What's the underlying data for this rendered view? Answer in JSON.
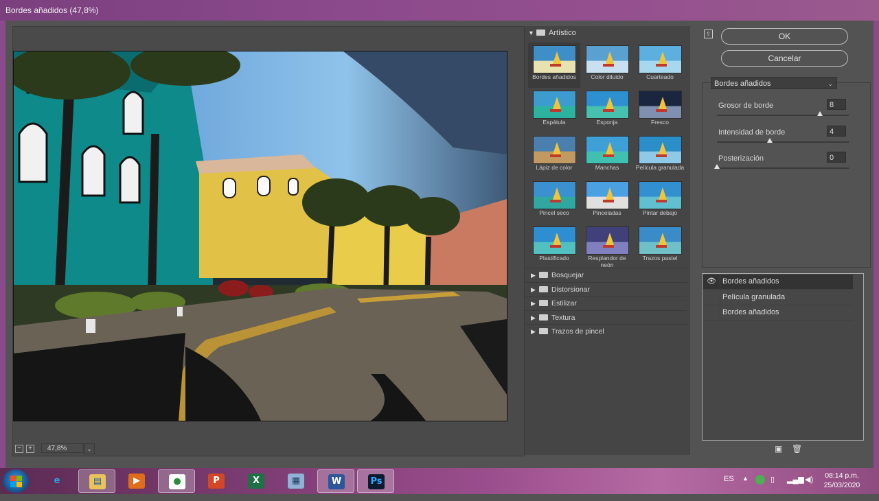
{
  "window": {
    "title": "Bordes añadidos (47,8%)"
  },
  "preview": {
    "zoom_out": "−",
    "zoom_in": "+",
    "zoom_value": "47,8%",
    "zoom_dropdown": "⌄"
  },
  "gallery": {
    "open_category": "Artístico",
    "thumbnails": [
      {
        "label": "Bordes añadidos",
        "selected": true
      },
      {
        "label": "Color diluido"
      },
      {
        "label": "Cuarteado"
      },
      {
        "label": "Espátula"
      },
      {
        "label": "Esponja"
      },
      {
        "label": "Fresco"
      },
      {
        "label": "Lápiz de color"
      },
      {
        "label": "Manchas"
      },
      {
        "label": "Película granulada"
      },
      {
        "label": "Pincel seco"
      },
      {
        "label": "Pinceladas"
      },
      {
        "label": "Pintar debajo"
      },
      {
        "label": "Plastificado"
      },
      {
        "label": "Resplandor de neón"
      },
      {
        "label": "Trazos pastel"
      }
    ],
    "categories": [
      "Bosquejar",
      "Distorsionar",
      "Estilizar",
      "Textura",
      "Trazos de pincel"
    ]
  },
  "actions": {
    "ok": "OK",
    "cancel": "Cancelar"
  },
  "settings": {
    "filter_select": "Bordes añadidos",
    "params": [
      {
        "label": "Grosor de borde",
        "value": "8",
        "fraction": 0.78
      },
      {
        "label": "Intensidad de borde",
        "value": "4",
        "fraction": 0.4
      },
      {
        "label": "Posterización",
        "value": "0",
        "fraction": 0.0
      }
    ]
  },
  "layers": [
    {
      "name": "Bordes añadidos",
      "visible": true,
      "active": true
    },
    {
      "name": "Película granulada"
    },
    {
      "name": "Bordes añadidos"
    }
  ],
  "taskbar": {
    "language": "ES",
    "time": "08:14 p.m.",
    "date": "25/03/2020",
    "apps": [
      {
        "name": "Internet Explorer",
        "glyph": "e"
      },
      {
        "name": "Explorador de archivos",
        "glyph": "▤"
      },
      {
        "name": "Reproductor multimedia",
        "glyph": "▶"
      },
      {
        "name": "Google Chrome",
        "glyph": "●"
      },
      {
        "name": "PowerPoint",
        "glyph": "P"
      },
      {
        "name": "Excel",
        "glyph": "X"
      },
      {
        "name": "Calculadora",
        "glyph": "▦"
      },
      {
        "name": "Word",
        "glyph": "W"
      },
      {
        "name": "Photoshop",
        "glyph": "Ps"
      }
    ]
  },
  "colors": {
    "dialog_bg": "#535353",
    "titlebar": "#8b4a8c",
    "taskbar": "#7d3d73"
  },
  "icons": {
    "collapse": "collapse-panel-icon",
    "eye": "eye-icon",
    "new_layer": "new-effect-layer-icon",
    "delete_layer": "trash-icon"
  }
}
